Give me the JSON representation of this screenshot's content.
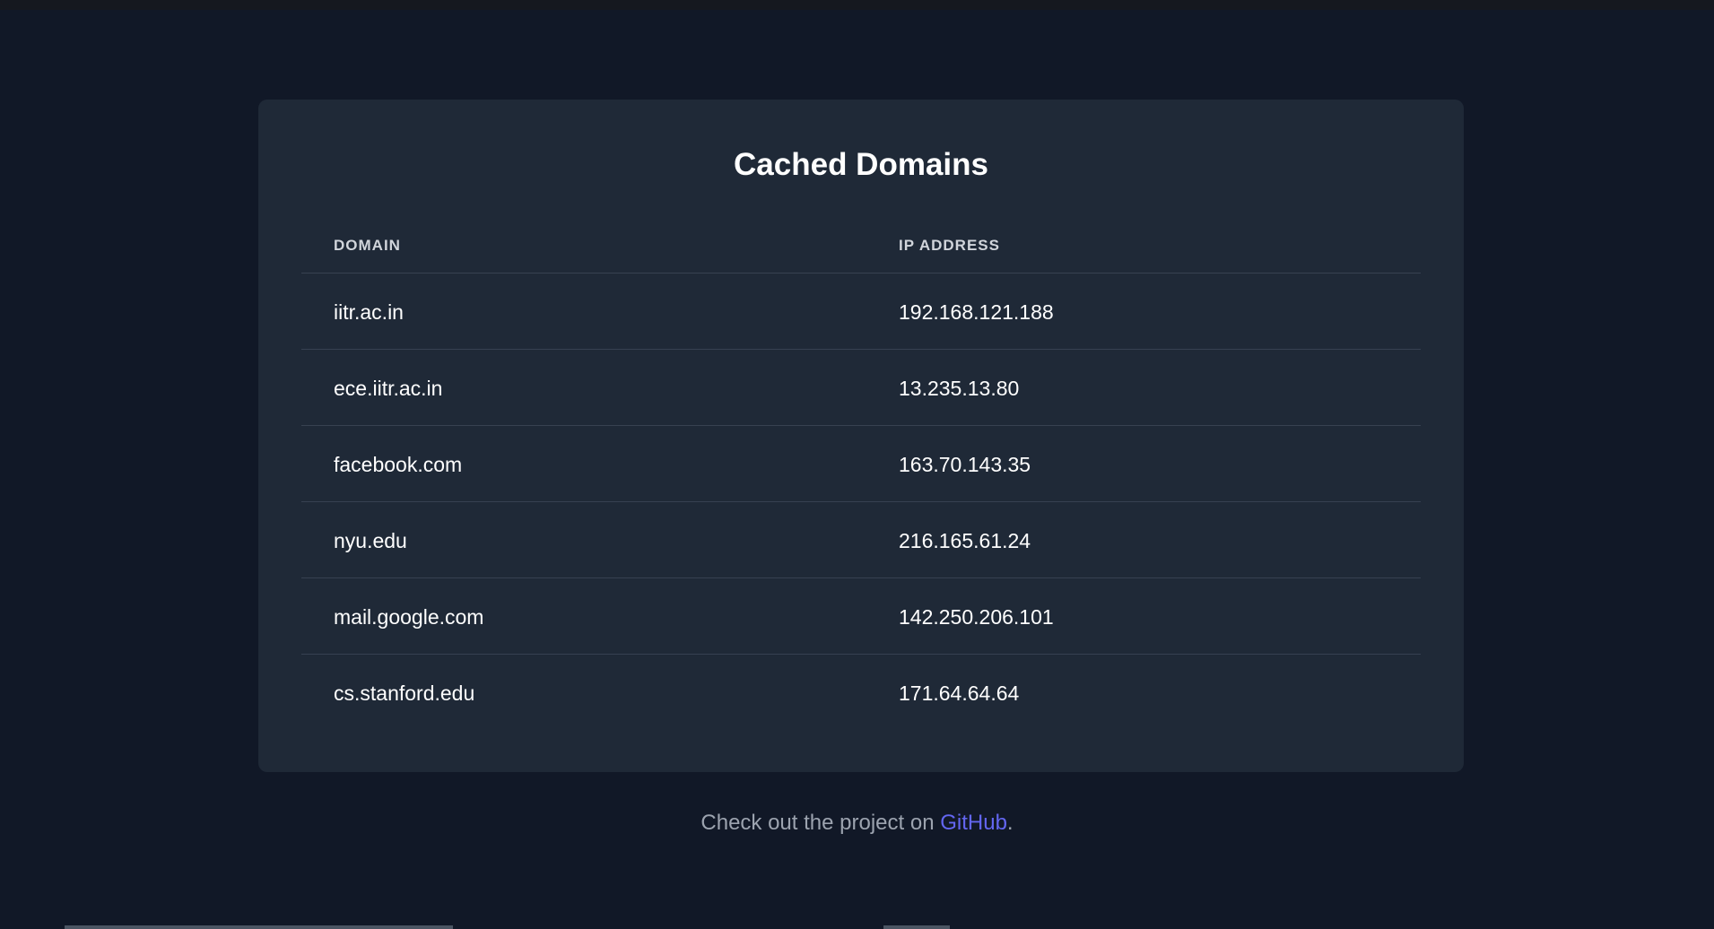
{
  "card": {
    "title": "Cached Domains"
  },
  "table": {
    "headers": [
      "DOMAIN",
      "IP ADDRESS"
    ],
    "rows": [
      {
        "domain": "iitr.ac.in",
        "ip": "192.168.121.188"
      },
      {
        "domain": "ece.iitr.ac.in",
        "ip": "13.235.13.80"
      },
      {
        "domain": "facebook.com",
        "ip": "163.70.143.35"
      },
      {
        "domain": "nyu.edu",
        "ip": "216.165.61.24"
      },
      {
        "domain": "mail.google.com",
        "ip": "142.250.206.101"
      },
      {
        "domain": "cs.stanford.edu",
        "ip": "171.64.64.64"
      }
    ]
  },
  "footer": {
    "prefix": "Check out the project on ",
    "link_label": "GitHub",
    "suffix": "."
  },
  "colors": {
    "page_background": "#111827",
    "card_background": "#1f2937",
    "divider": "#374151",
    "link": "#6366f1",
    "muted_text": "#9ca3af"
  }
}
